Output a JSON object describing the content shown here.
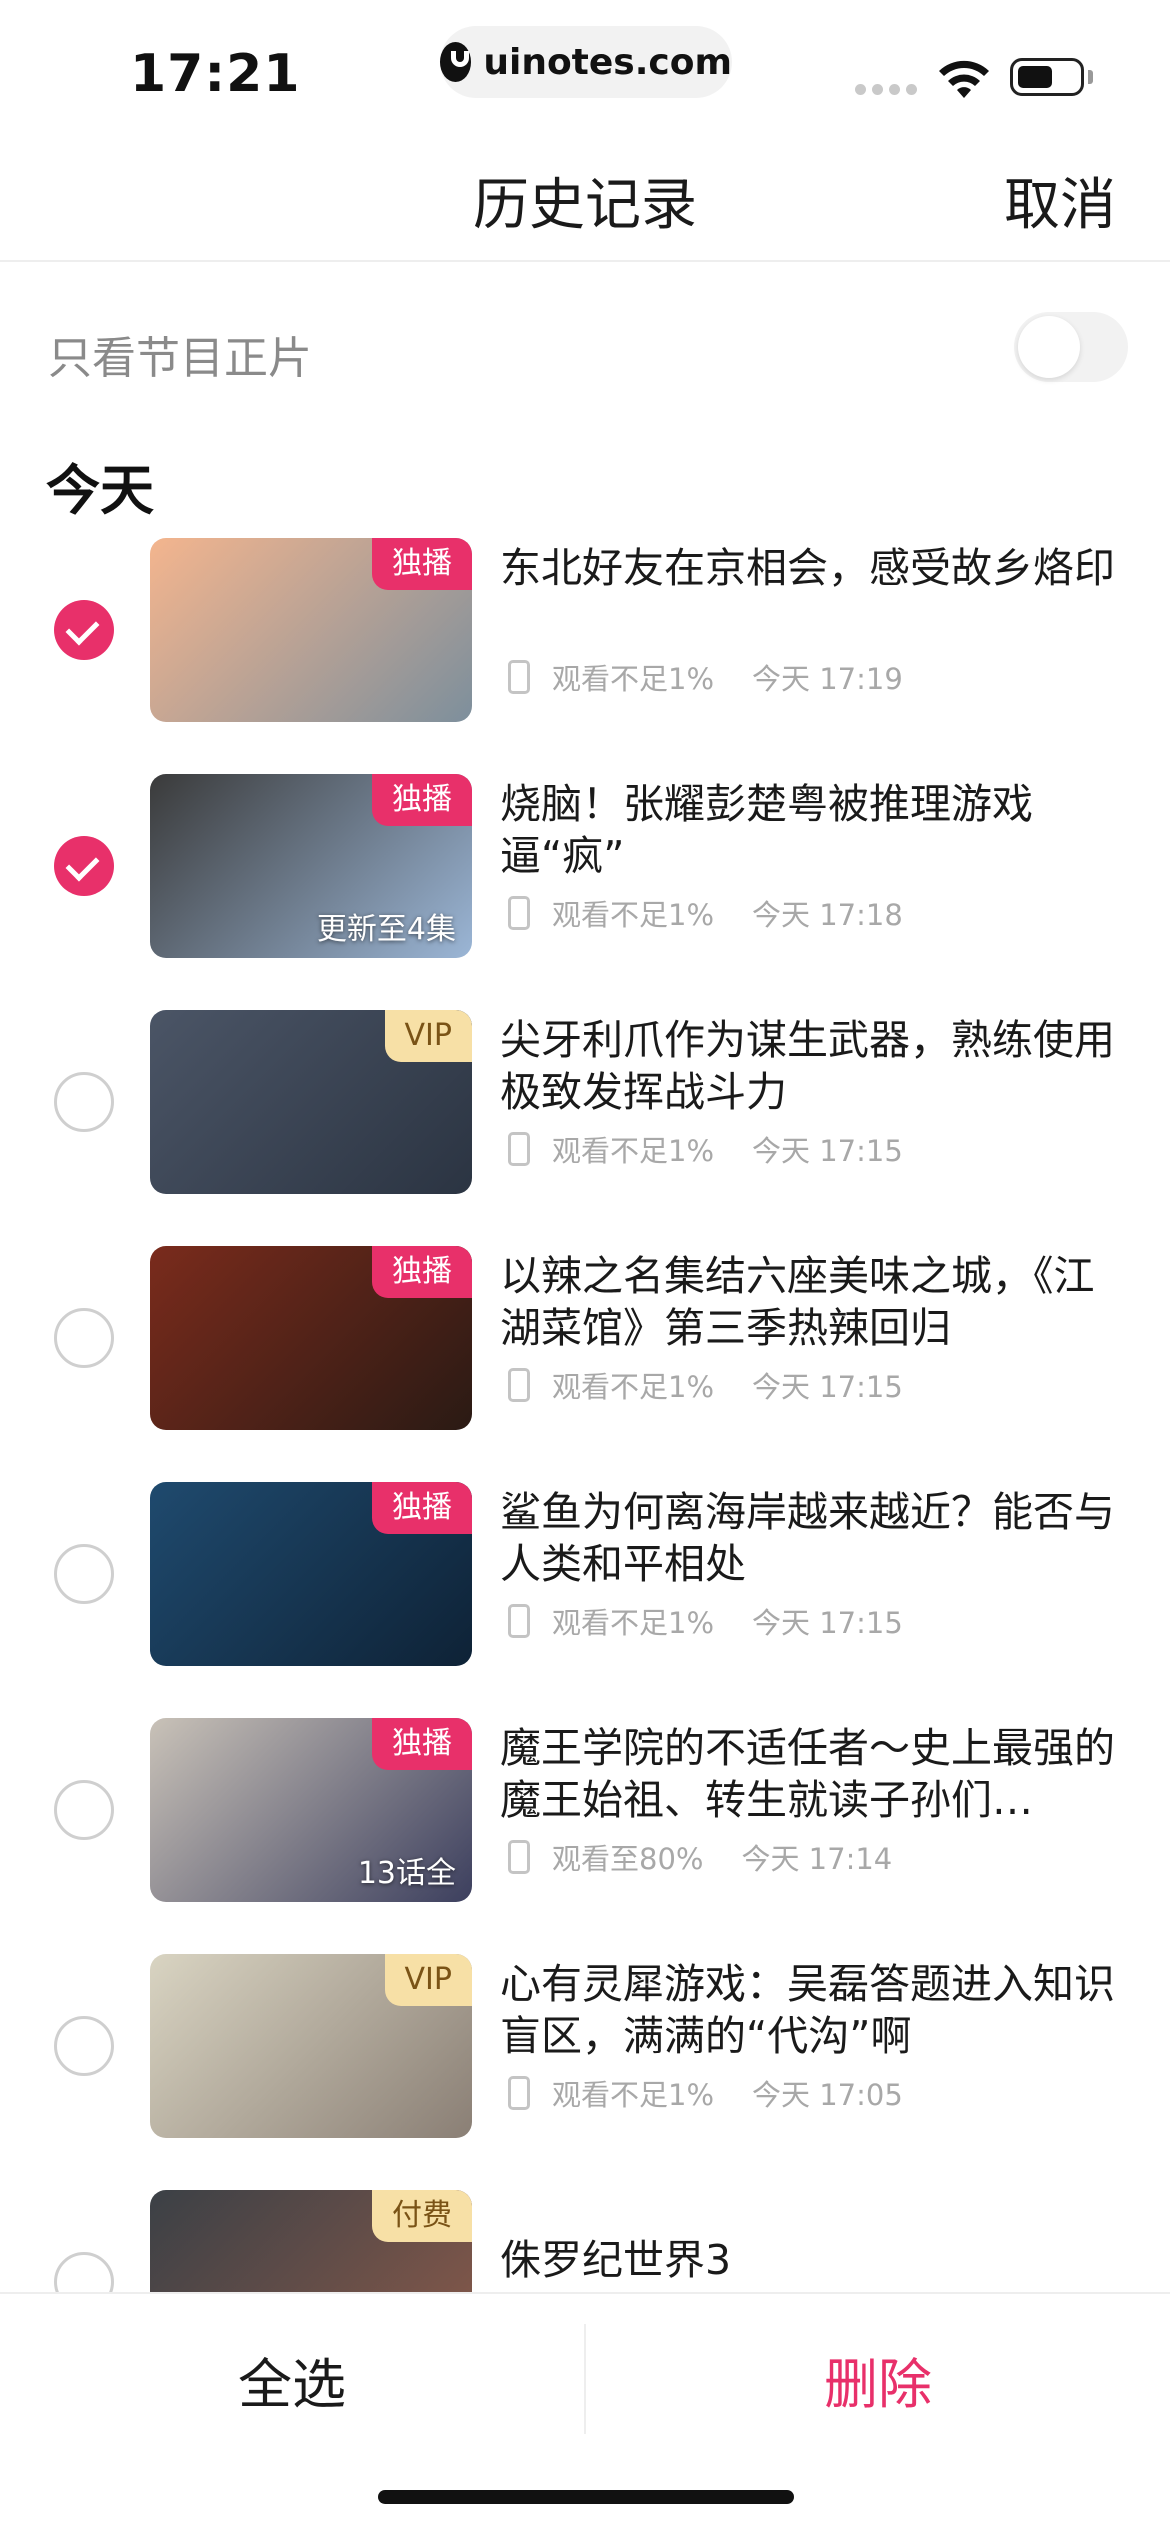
{
  "status_bar": {
    "time": "17:21",
    "url": "uinotes.com"
  },
  "nav": {
    "title": "历史记录",
    "cancel_label": "取消"
  },
  "filter": {
    "label": "只看节目正片",
    "enabled": false
  },
  "section": {
    "title": "今天"
  },
  "items": [
    {
      "title": "东北好友在京相会，感受故乡烙印",
      "badge": "独播",
      "badge_type": "exclusive",
      "caption": "",
      "progress": "观看不足1%",
      "time": "今天 17:19",
      "checked": true,
      "thumb_colors": [
        "#f4b58e",
        "#7d8f9c"
      ]
    },
    {
      "title": "烧脑！张耀彭楚粤被推理游戏逼“疯”",
      "badge": "独播",
      "badge_type": "exclusive",
      "caption": "更新至4集",
      "progress": "观看不足1%",
      "time": "今天 17:18",
      "checked": true,
      "thumb_colors": [
        "#3a3a3a",
        "#9bb6d6"
      ]
    },
    {
      "title": "尖牙利爪作为谋生武器，熟练使用极致发挥战斗力",
      "badge": "VIP",
      "badge_type": "vip",
      "caption": "",
      "progress": "观看不足1%",
      "time": "今天 17:15",
      "checked": false,
      "thumb_colors": [
        "#4b5566",
        "#2b3442"
      ]
    },
    {
      "title": "以辣之名集结六座美味之城，《江湖菜馆》第三季热辣回归",
      "badge": "独播",
      "badge_type": "exclusive",
      "caption": "",
      "progress": "观看不足1%",
      "time": "今天 17:15",
      "checked": false,
      "thumb_colors": [
        "#7a2b1c",
        "#2a1a14"
      ]
    },
    {
      "title": "鲨鱼为何离海岸越来越近？能否与人类和平相处",
      "badge": "独播",
      "badge_type": "exclusive",
      "caption": "",
      "progress": "观看不足1%",
      "time": "今天 17:15",
      "checked": false,
      "thumb_colors": [
        "#1f4a6e",
        "#0e2236"
      ]
    },
    {
      "title": "魔王学院的不适任者～史上最强的魔王始祖、转生就读子孙们…",
      "badge": "独播",
      "badge_type": "exclusive",
      "caption": "13话全",
      "progress": "观看至80%",
      "time": "今天 17:14",
      "checked": false,
      "thumb_colors": [
        "#c9c2b8",
        "#3c3f5e"
      ]
    },
    {
      "title": "心有灵犀游戏：吴磊答题进入知识盲区，满满的“代沟”啊",
      "badge": "VIP",
      "badge_type": "vip",
      "caption": "",
      "progress": "观看不足1%",
      "time": "今天 17:05",
      "checked": false,
      "thumb_colors": [
        "#d9d4c2",
        "#8a7f75"
      ]
    },
    {
      "title": "侏罗纪世界3",
      "badge": "付费",
      "badge_type": "paid",
      "caption": "",
      "progress": "",
      "time": "",
      "checked": false,
      "thumb_colors": [
        "#3b4046",
        "#8a5a4a"
      ]
    }
  ],
  "bottom": {
    "select_all_label": "全选",
    "delete_label": "删除"
  },
  "colors": {
    "accent": "#e8306a",
    "vip_badge": "#f7e0a6"
  }
}
